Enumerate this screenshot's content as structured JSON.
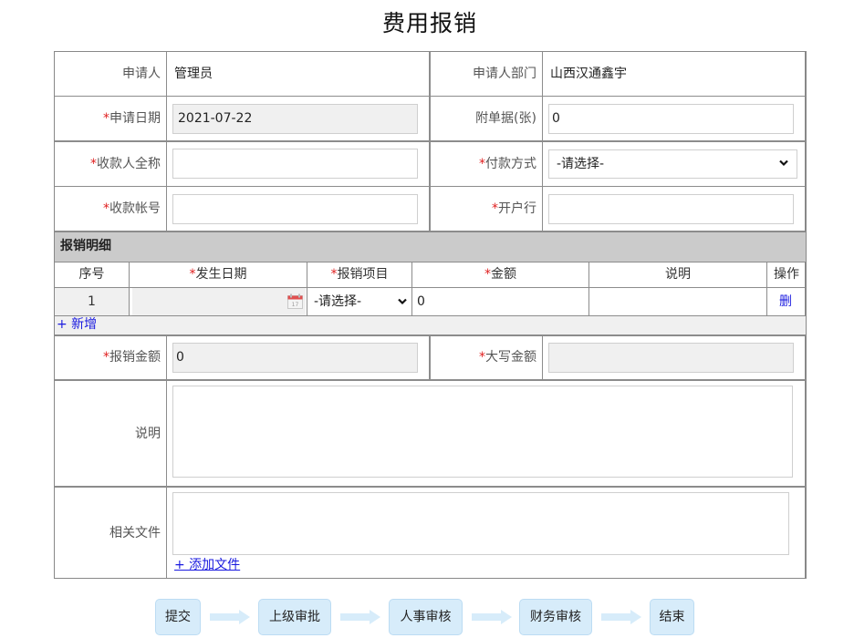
{
  "page_title": "费用报销",
  "form": {
    "applicant": {
      "label": "申请人",
      "value": "管理员"
    },
    "department": {
      "label": "申请人部门",
      "value": "山西汉通鑫宇"
    },
    "apply_date": {
      "required": "*",
      "label": "申请日期",
      "value": "2021-07-22"
    },
    "attachments": {
      "label": "附单据(张)",
      "value": "0"
    },
    "payee_name": {
      "required": "*",
      "label": "收款人全称",
      "value": ""
    },
    "payment_method": {
      "required": "*",
      "label": "付款方式",
      "selected": "-请选择-"
    },
    "account_no": {
      "required": "*",
      "label": "收款帐号",
      "value": ""
    },
    "bank": {
      "required": "*",
      "label": "开户行",
      "value": ""
    }
  },
  "details": {
    "section_title": "报销明细",
    "columns": [
      {
        "required": "",
        "label": "序号"
      },
      {
        "required": "*",
        "label": "发生日期"
      },
      {
        "required": "*",
        "label": "报销项目"
      },
      {
        "required": "*",
        "label": "金额"
      },
      {
        "required": "",
        "label": "说明"
      },
      {
        "required": "",
        "label": "操作"
      }
    ],
    "rows": [
      {
        "index": "1",
        "date": "",
        "item_selected": "-请选择-",
        "amount": "0",
        "note": "",
        "action": "删"
      }
    ],
    "add_label": "+ 新增"
  },
  "totals": {
    "amount": {
      "required": "*",
      "label": "报销金额",
      "value": "0"
    },
    "amount_upper": {
      "required": "*",
      "label": "大写金额",
      "value": ""
    }
  },
  "description": {
    "label": "说明",
    "value": ""
  },
  "files": {
    "label": "相关文件",
    "add_label": "+ 添加文件"
  },
  "workflow": {
    "steps": [
      "提交",
      "上级审批",
      "人事审核",
      "财务审核",
      "结束"
    ],
    "step_color": "#d7ecfa",
    "arrow_color": "#d7ecfa"
  },
  "colors": {
    "required": "#e02020",
    "link": "#1a1adf",
    "section_bg": "#cbcbcb",
    "readonly_bg": "#f0f0f0"
  }
}
